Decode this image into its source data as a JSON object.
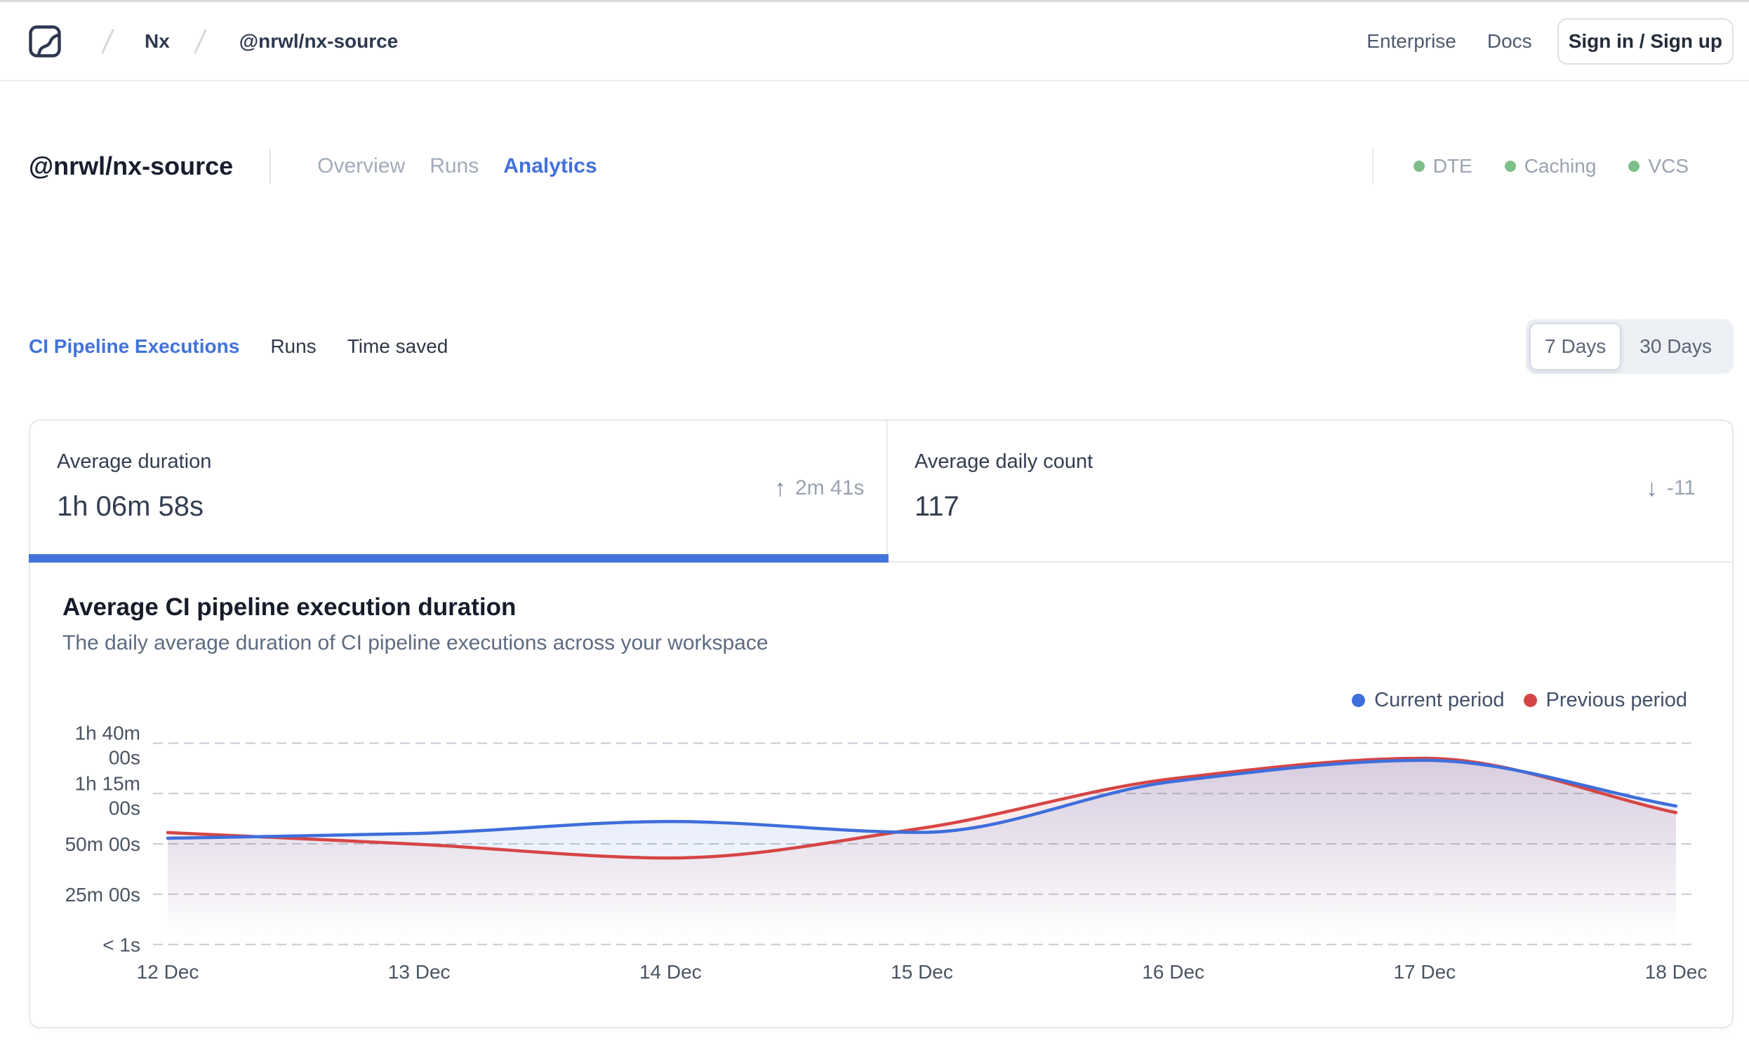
{
  "top_nav": {
    "brand": "Nx Cloud",
    "breadcrumbs": [
      {
        "label": "Nx"
      },
      {
        "label": "@nrwl/nx-source"
      }
    ],
    "links": [
      {
        "label": "Enterprise"
      },
      {
        "label": "Docs"
      }
    ],
    "sign_in_label": "Sign in / Sign up"
  },
  "workspace_header": {
    "title": "@nrwl/nx-source",
    "tabs": [
      {
        "label": "Overview",
        "active": false
      },
      {
        "label": "Runs",
        "active": false
      },
      {
        "label": "Analytics",
        "active": true
      }
    ],
    "status_indicators": [
      {
        "label": "DTE",
        "status_color": "#7dbf88"
      },
      {
        "label": "Caching",
        "status_color": "#7dbf88"
      },
      {
        "label": "VCS",
        "status_color": "#7dbf88"
      }
    ]
  },
  "analytics_tabs": [
    {
      "label": "CI Pipeline Executions",
      "active": true
    },
    {
      "label": "Runs",
      "active": false
    },
    {
      "label": "Time saved",
      "active": false
    }
  ],
  "range_toggle": [
    {
      "label": "7 Days",
      "selected": true
    },
    {
      "label": "30 Days",
      "selected": false
    }
  ],
  "stat_cards": [
    {
      "label": "Average duration",
      "value": "1h 06m 58s",
      "delta": "2m 41s",
      "delta_direction": "up",
      "selected": true
    },
    {
      "label": "Average daily count",
      "value": "117",
      "delta": "-11",
      "delta_direction": "down",
      "selected": false
    }
  ],
  "delta_arrows": {
    "up": "↑",
    "down": "↓"
  },
  "chart_data": {
    "type": "area",
    "title": "Average CI pipeline execution duration",
    "subtitle": "The daily average duration of CI pipeline executions across your workspace",
    "x_labels": [
      "12 Dec",
      "13 Dec",
      "14 Dec",
      "15 Dec",
      "16 Dec",
      "17 Dec",
      "18 Dec"
    ],
    "y_tick_labels": [
      [
        "1h 40m",
        "00s"
      ],
      [
        "1h 15m",
        "00s"
      ],
      [
        "50m 00s"
      ],
      [
        "25m 00s"
      ],
      [
        "< 1s"
      ]
    ],
    "y_tick_minutes": [
      100,
      75,
      50,
      25,
      0
    ],
    "ylim": [
      0,
      100
    ],
    "unit": "minutes",
    "grid": "dashed-horizontal",
    "legend_position": "top-right",
    "series": [
      {
        "name": "Current period",
        "color": "#3e6edb",
        "values": [
          52.8,
          55.2,
          61.1,
          55.7,
          81.0,
          91.5,
          68.8
        ]
      },
      {
        "name": "Previous period",
        "color": "#d64545",
        "values": [
          55.6,
          49.8,
          43.0,
          57.8,
          82.4,
          92.5,
          65.5
        ]
      }
    ]
  },
  "colors": {
    "accent_blue": "#4470da",
    "current_line": "#3e6edb",
    "previous_line": "#d64545",
    "status_green": "#7dbf88",
    "grid_line": "#c8ccd3"
  }
}
